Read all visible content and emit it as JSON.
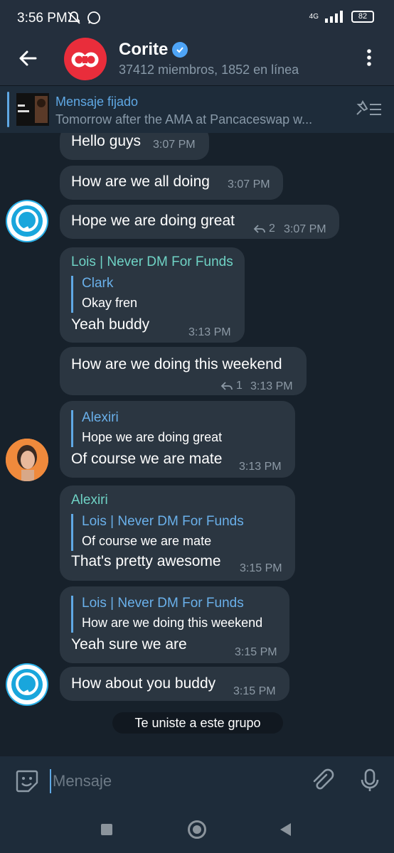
{
  "status_bar": {
    "time": "3:56 PM",
    "network": "4G",
    "battery": "82"
  },
  "header": {
    "title": "Corite",
    "subtitle": "37412 miembros, 1852 en línea"
  },
  "pinned": {
    "label": "Mensaje fijado",
    "text": "Tomorrow after the AMA at Pancaceswap w..."
  },
  "messages": [
    {
      "text": "Hello guys",
      "time": "3:07 PM"
    },
    {
      "text": "How are we all doing",
      "time": "3:07 PM"
    },
    {
      "text": "Hope we are doing great",
      "time": "3:07 PM",
      "replies": "2"
    },
    {
      "sender": "Lois | Never DM For Funds",
      "quote_name": "Clark",
      "quote_text": "Okay fren",
      "text": "Yeah buddy",
      "time": "3:13 PM"
    },
    {
      "text": "How are we doing this weekend",
      "time": "3:13 PM",
      "replies": "1"
    },
    {
      "quote_name": "Alexiri",
      "quote_text": "Hope we are doing great",
      "text": "Of course we are mate",
      "time": "3:13 PM"
    },
    {
      "sender": "Alexiri",
      "quote_name": "Lois | Never DM For Funds",
      "quote_text": "Of course we are mate",
      "text": "That's pretty awesome",
      "time": "3:15 PM"
    },
    {
      "quote_name": "Lois | Never DM For Funds",
      "quote_text": "How are we doing this weekend",
      "text": "Yeah sure  we are",
      "time": "3:15 PM"
    },
    {
      "text": "How about you buddy",
      "time": "3:15 PM"
    }
  ],
  "service_message": "Te uniste a este grupo",
  "input": {
    "placeholder": "Mensaje"
  },
  "colors": {
    "accent": "#5fa8e4",
    "sender": "#6fd3c5",
    "bubble": "#2b3641",
    "background": "#17212b"
  }
}
